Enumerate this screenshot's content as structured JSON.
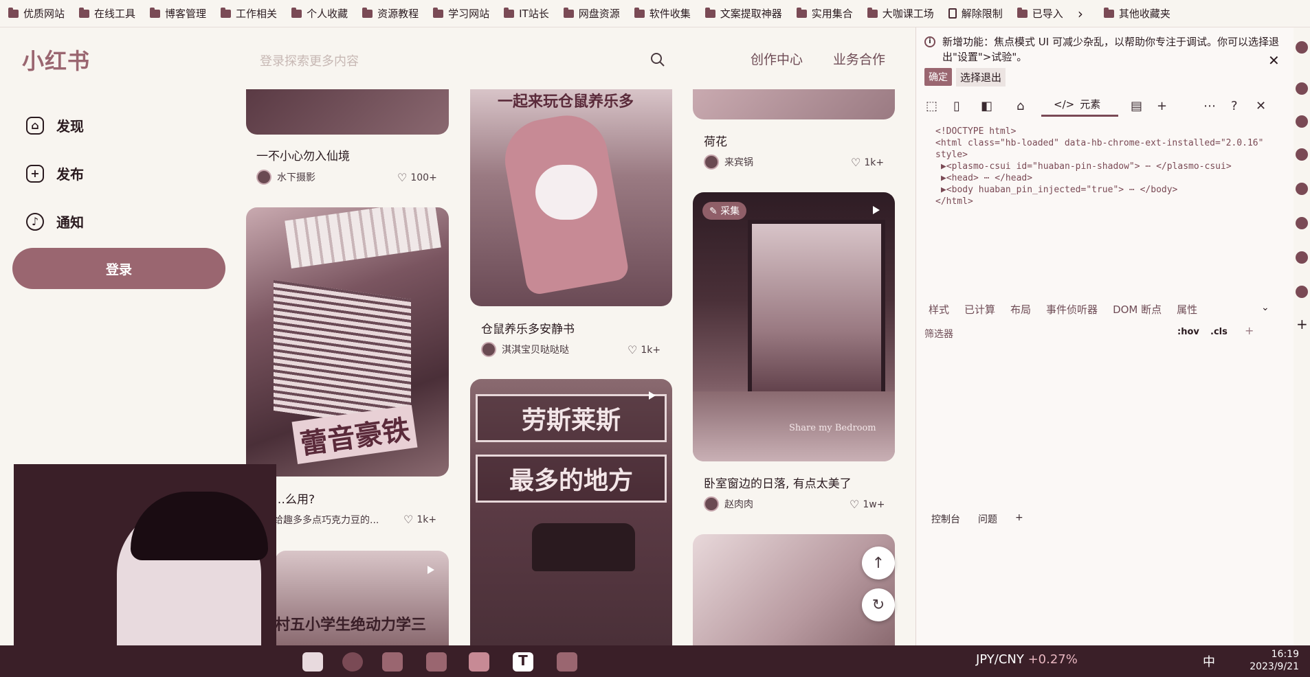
{
  "bookmarks": [
    "优质网站",
    "在线工具",
    "博客管理",
    "工作相关",
    "个人收藏",
    "资源教程",
    "学习网站",
    "IT站长",
    "网盘资源",
    "软件收集",
    "文案提取神器",
    "实用集合",
    "大咖课工场",
    "解除限制",
    "已导入",
    "其他收藏夹"
  ],
  "logo": "小红书",
  "nav": {
    "discover": "发现",
    "publish": "发布",
    "notify": "通知"
  },
  "login": "登录",
  "search": {
    "placeholder": "登录探索更多内容"
  },
  "top_links": {
    "creator": "创作中心",
    "business": "业务合作"
  },
  "cards": [
    {
      "title": "一不小心勿入仙境",
      "author": "水下摄影",
      "likes": "100+"
    },
    {
      "title": "仓鼠养乐多安静书",
      "author": "淇淇宝贝哒哒哒",
      "likes": "1k+"
    },
    {
      "title": "荷花",
      "author": "来宾锅",
      "likes": "1k+"
    },
    {
      "title": "…么用?",
      "author": "给趣多多点巧克力豆的...",
      "likes": "1k+"
    },
    {
      "title": "卧室窗边的日落, 有点太美了",
      "author": "赵肉肉",
      "likes": "1w+"
    }
  ],
  "image_texts": {
    "rolls_line1": "劳斯莱斯",
    "rolls_line2": "最多的地方",
    "badge": "采集",
    "bedroom": "Share my Bedroom",
    "keyboard_box": "蕾音豪铁",
    "hamster_top": "一起来玩仓鼠养乐多",
    "bottom_left": "村五小学生绝动力学三"
  },
  "devtools": {
    "notice": "新增功能：焦点模式 UI 可减少杂乱，以帮助你专注于调试。你可以选择退出\"设置\">试验\"。",
    "ok": "确定",
    "exit": "选择退出",
    "elements_tab": "元素",
    "code": [
      "<!DOCTYPE html>",
      "<html class=\"hb-loaded\" data-hb-chrome-ext-installed=\"2.0.16\"",
      "style>",
      "▶<plasmo-csui id=\"huaban-pin-shadow\"> ⋯ </plasmo-csui>",
      "▶<head> ⋯ </head>",
      "▶<body huaban_pin_injected=\"true\"> ⋯ </body>",
      "</html>"
    ],
    "tabs": [
      "样式",
      "已计算",
      "布局",
      "事件侦听器",
      "DOM 断点",
      "属性"
    ],
    "filter": "筛选器",
    "hov": ":hov",
    "cls": ".cls",
    "console_tabs": [
      "控制台",
      "问题"
    ]
  },
  "taskbar": {
    "currency": "JPY/CNY",
    "change": "+0.27%",
    "ime": "中",
    "time": "16:19",
    "date": "2023/9/21"
  }
}
